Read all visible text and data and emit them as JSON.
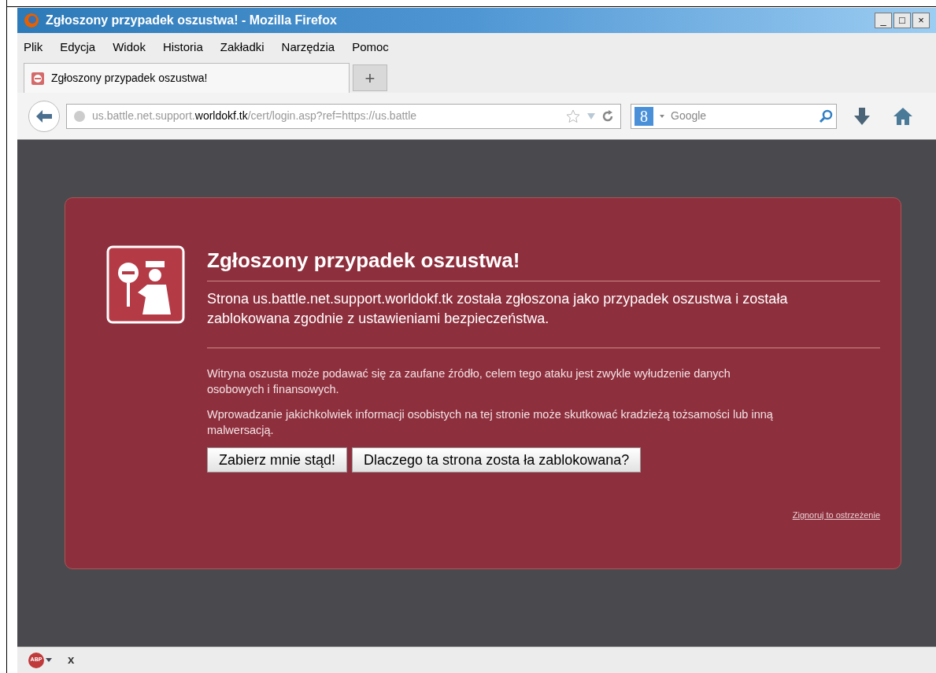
{
  "window": {
    "title": "Zgłoszony przypadek oszustwa! - Mozilla Firefox",
    "controls": [
      "_",
      "□",
      "×"
    ]
  },
  "menu": [
    {
      "label": "Plik"
    },
    {
      "label": "Edycja"
    },
    {
      "label": "Widok"
    },
    {
      "label": "Historia"
    },
    {
      "label": "Zakładki"
    },
    {
      "label": "Narzędzia"
    },
    {
      "label": "Pomoc"
    }
  ],
  "tabs": [
    {
      "label": "Zgłoszony przypadek oszustwa!",
      "selected": true
    }
  ],
  "new_tab": "+",
  "address_bar": {
    "prefix": "us.battle.net.support.",
    "domain": "worldokf.tk",
    "suffix": "/cert/login.asp?ref=https://us.battle"
  },
  "search": {
    "engine_icon": "8",
    "placeholder": "Google"
  },
  "warning": {
    "title": "Zgłoszony przypadek oszustwa!",
    "summary": "Strona us.battle.net.support.worldokf.tk została zgłoszona jako przypadek oszustwa i została zablokowana zgodnie z ustawieniami bezpieczeństwa.",
    "paragraphs": [
      "Witryna oszusta może podawać się za zaufane źródło, celem tego ataku jest zwykle wyłudzenie danych osobowych i finansowych.",
      "Wprowadzanie jakichkolwiek informacji osobistych na tej stronie może skutkować kradzieżą tożsamości lub inną malwersacją."
    ],
    "buttons": [
      "Zabierz mnie stąd!",
      "Dlaczego ta strona zosta ła zablokowana?"
    ],
    "ignore_link": "Zignoruj to ostrzeżenie"
  },
  "addon_bar": {
    "badge": "ABP",
    "close": "x"
  }
}
